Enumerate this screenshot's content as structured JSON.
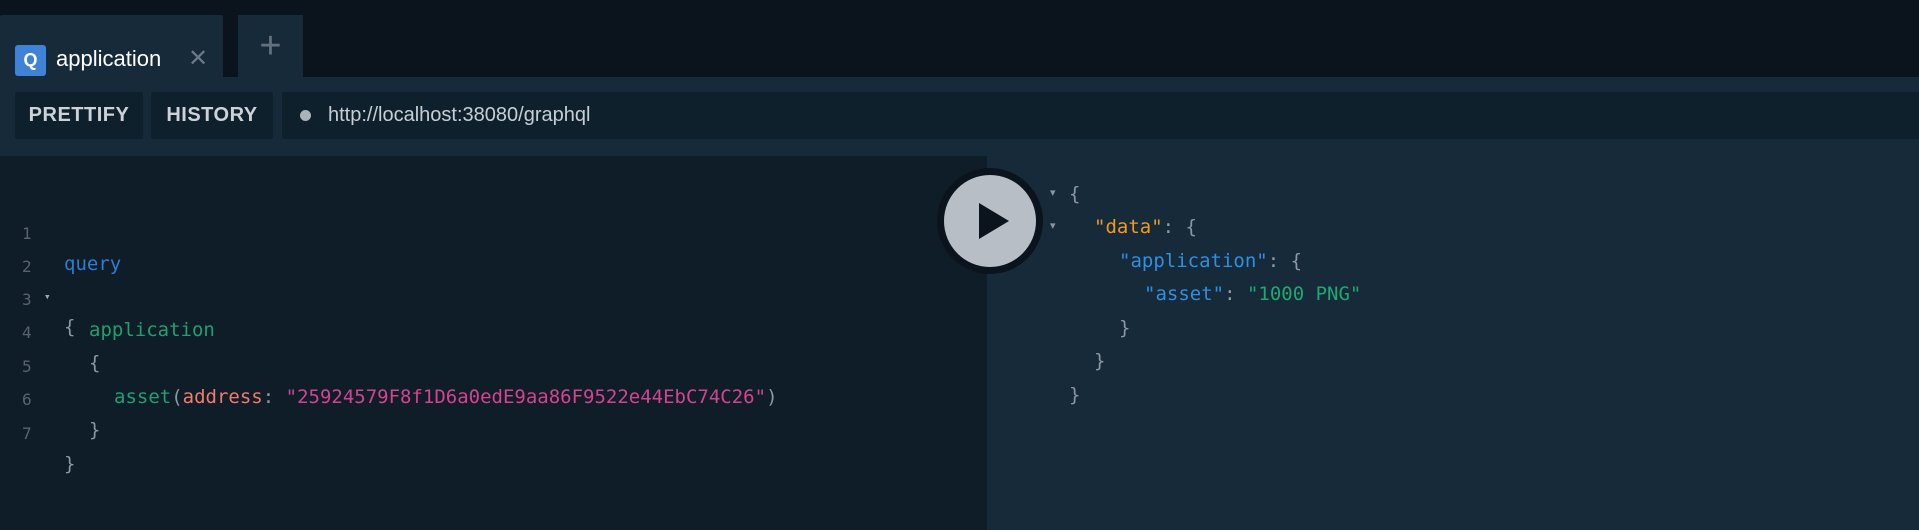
{
  "tabs": [
    {
      "badge": "Q",
      "title": "application",
      "close": "✕"
    }
  ],
  "tab_add_label": "+",
  "toolbar": {
    "prettify_label": "PRETTIFY",
    "history_label": "HISTORY",
    "endpoint_url": "http://localhost:38080/graphql"
  },
  "editor": {
    "line_numbers": [
      "1",
      "2",
      "3",
      "4",
      "5",
      "6",
      "7"
    ],
    "tokens": {
      "query": "query",
      "open_brace": "{",
      "application": "application",
      "inner_open": "{",
      "asset": "asset",
      "paren_open": "(",
      "arg_name": "address",
      "colon": ": ",
      "arg_value": "\"25924579F8f1D6a0edE9aa86F9522e44EbC74C26\"",
      "paren_close": ")",
      "inner_close": "}",
      "close_brace": "}"
    }
  },
  "result": {
    "open": "{",
    "data_key": "\"data\"",
    "colon": ": ",
    "data_open": "{",
    "application_key": "\"application\"",
    "application_open": "{",
    "asset_key": "\"asset\"",
    "asset_value": "\"1000 PNG\"",
    "application_close": "}",
    "data_close": "}",
    "close": "}"
  },
  "icons": {
    "fold_marker": "▾",
    "execute": "play-icon"
  },
  "colors": {
    "background": "#0f1923",
    "tab_active": "#172a3a",
    "badge": "#3e83d6",
    "keyword": "#2a7ed3",
    "field": "#1ea070",
    "argument": "#f07b6e",
    "string": "#d64292",
    "result_key": "#f29a1b",
    "result_string": "#1fa86f"
  }
}
